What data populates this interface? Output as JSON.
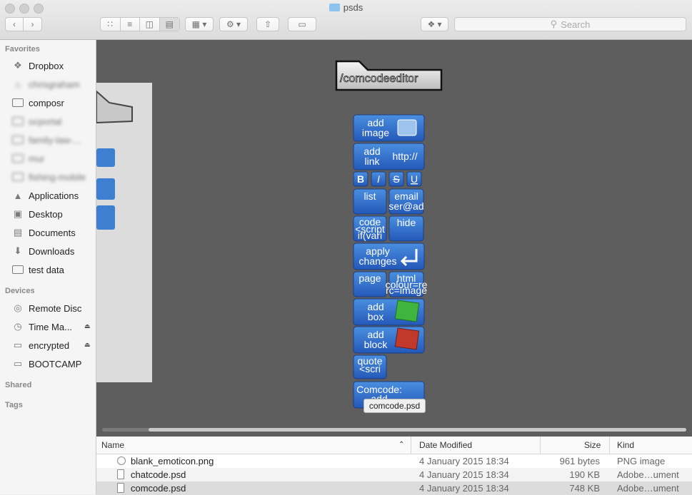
{
  "window": {
    "title": "psds"
  },
  "toolbar": {
    "search_placeholder": "Search",
    "icons": [
      "chevron-left-icon",
      "chevron-right-icon",
      "icon-view-icon",
      "list-view-icon",
      "column-view-icon",
      "cover-flow-icon",
      "arrange-icon",
      "gear-icon",
      "share-icon",
      "tag-icon",
      "dropbox-icon"
    ]
  },
  "sidebar": {
    "favorites_label": "Favorites",
    "devices_label": "Devices",
    "shared_label": "Shared",
    "tags_label": "Tags",
    "favorites": [
      {
        "label": "Dropbox",
        "icon": "dropbox-icon"
      },
      {
        "label": "chrisgraham",
        "icon": "home-icon"
      },
      {
        "label": "composr",
        "icon": "folder-icon"
      },
      {
        "label": "ocportal",
        "icon": "folder-icon"
      },
      {
        "label": "family-law-...",
        "icon": "folder-icon"
      },
      {
        "label": "mur",
        "icon": "folder-icon"
      },
      {
        "label": "fishing-mobile",
        "icon": "folder-icon"
      },
      {
        "label": "Applications",
        "icon": "applications-icon"
      },
      {
        "label": "Desktop",
        "icon": "desktop-icon"
      },
      {
        "label": "Documents",
        "icon": "documents-icon"
      },
      {
        "label": "Downloads",
        "icon": "downloads-icon"
      },
      {
        "label": "test data",
        "icon": "folder-icon"
      }
    ],
    "devices": [
      {
        "label": "Remote Disc",
        "icon": "disc-icon"
      },
      {
        "label": "Time Ma...",
        "icon": "time-machine-icon"
      },
      {
        "label": "encrypted",
        "icon": "drive-icon"
      },
      {
        "label": "BOOTCAMP",
        "icon": "drive-icon"
      }
    ]
  },
  "preview": {
    "folder_label": "/comcodeeditor",
    "buttons": {
      "add_image": [
        "add",
        "image"
      ],
      "add_link": [
        "add",
        "link"
      ],
      "link_glyph": "http://",
      "format": [
        "B",
        "I",
        "S",
        "U"
      ],
      "list": "list",
      "email": [
        "email",
        "ser@ad"
      ],
      "code": [
        "code",
        "<script",
        "if(vari"
      ],
      "hide": "hide",
      "apply": [
        "apply",
        "changes"
      ],
      "page": "page",
      "html": [
        "html",
        "colour=re",
        "rc=image"
      ],
      "add_box": [
        "add",
        "box"
      ],
      "add_block": [
        "add",
        "block"
      ],
      "quote": [
        "quote",
        "<scri"
      ],
      "comcode": [
        "Comcode:",
        "add"
      ]
    },
    "tooltip": "comcode.psd"
  },
  "file_list": {
    "columns": {
      "name": "Name",
      "date": "Date Modified",
      "size": "Size",
      "kind": "Kind"
    },
    "rows": [
      {
        "name": "blank_emoticon.png",
        "date": "4 January 2015 18:34",
        "size": "961 bytes",
        "kind": "PNG image"
      },
      {
        "name": "chatcode.psd",
        "date": "4 January 2015 18:34",
        "size": "190 KB",
        "kind": "Adobe…ument"
      },
      {
        "name": "comcode.psd",
        "date": "4 January 2015 18:34",
        "size": "748 KB",
        "kind": "Adobe…ument"
      }
    ]
  }
}
